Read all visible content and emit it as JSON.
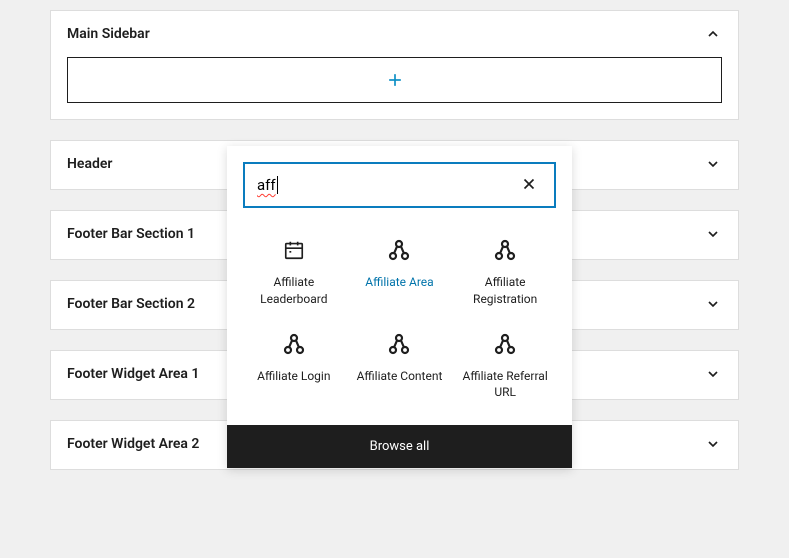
{
  "panels": {
    "main_sidebar": {
      "title": "Main Sidebar"
    },
    "header": {
      "title": "Header"
    },
    "footer_bar_1": {
      "title": "Footer Bar Section 1"
    },
    "footer_bar_2": {
      "title": "Footer Bar Section 2"
    },
    "footer_widget_1": {
      "title": "Footer Widget Area 1"
    },
    "footer_widget_2": {
      "title": "Footer Widget Area 2"
    }
  },
  "inserter": {
    "search_value": "aff",
    "browse_all_label": "Browse all",
    "results": {
      "affiliate_leaderboard": "Affiliate Leaderboard",
      "affiliate_area": "Affiliate Area",
      "affiliate_registration": "Affiliate Registration",
      "affiliate_login": "Affiliate Login",
      "affiliate_content": "Affiliate Content",
      "affiliate_referral_url": "Affiliate Referral URL"
    }
  }
}
